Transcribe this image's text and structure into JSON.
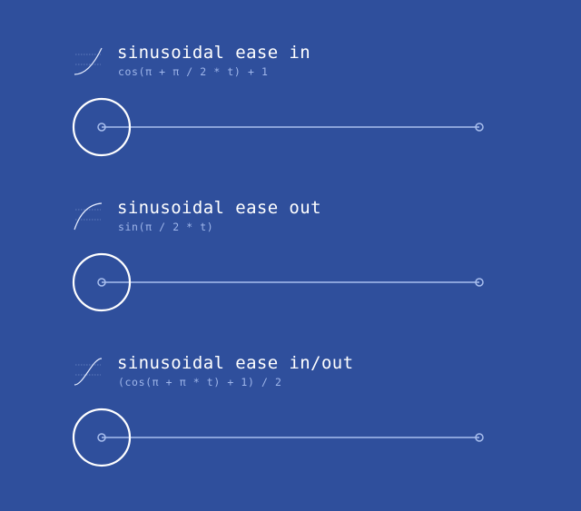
{
  "sections": [
    {
      "title": "sinusoidal ease in",
      "formula": "cos(π + π / 2 * t) + 1",
      "curve": "ease-in",
      "progress": 0
    },
    {
      "title": "sinusoidal ease out",
      "formula": "sin(π / 2 * t)",
      "curve": "ease-out",
      "progress": 0
    },
    {
      "title": "sinusoidal ease in/out",
      "formula": "(cos(π + π * t) + 1) / 2",
      "curve": "ease-in-out",
      "progress": 0
    }
  ],
  "colors": {
    "background": "#2f4f9c",
    "track": "#a9bfee",
    "ball": "#ffffff",
    "formula": "#9fb6ea"
  }
}
